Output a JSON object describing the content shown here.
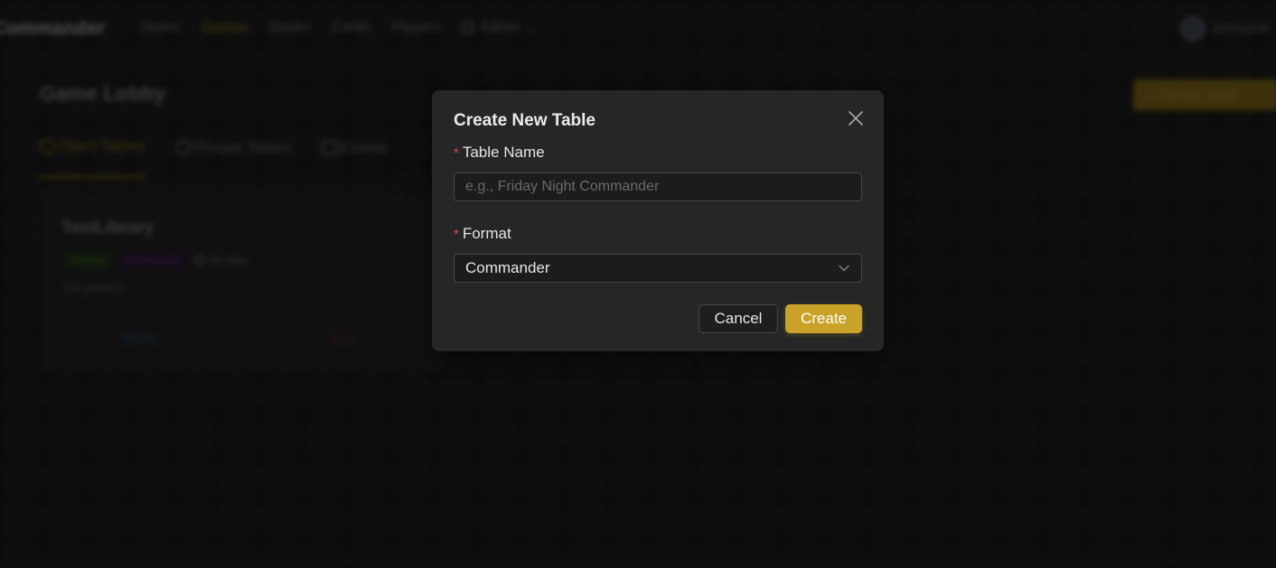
{
  "app": {
    "brand": "Commander",
    "nav": {
      "home": "Home",
      "games": "Games",
      "decks": "Decks",
      "cards": "Cards",
      "players": "Players",
      "admin": "Admin"
    },
    "user": {
      "name": "jimmyxie"
    },
    "page_title": "Game Lobby",
    "create_table_label": "Create Table",
    "tabs": {
      "open": "Open Tables",
      "private": "Private Tables",
      "events": "Events"
    },
    "table_card": {
      "title": "TestLibrary",
      "status_tag": "Playing",
      "format_tag": "commander",
      "time": "3h 58m",
      "players": "2/4 players",
      "rejoin_label": "Rejoin",
      "end_label": "End"
    }
  },
  "modal": {
    "title": "Create New Table",
    "table_name_label": "Table Name",
    "table_name_value": "",
    "table_name_placeholder": "e.g., Friday Night Commander",
    "format_label": "Format",
    "format_value": "Commander",
    "required_marker": "*",
    "cancel_label": "Cancel",
    "create_label": "Create"
  },
  "colors": {
    "accent": "#c9a227",
    "required": "#d84545",
    "modal_bg": "#262626"
  },
  "icons": {
    "close": "close-icon",
    "dropdown": "chevron-down-icon"
  }
}
